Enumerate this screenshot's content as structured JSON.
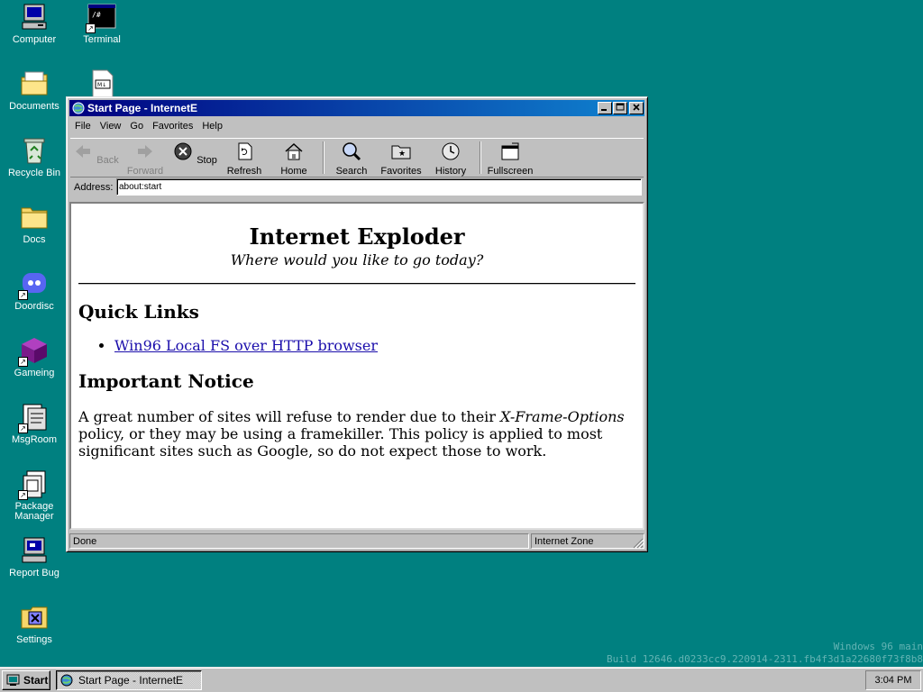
{
  "desktop": {
    "icons": [
      {
        "label": "Computer"
      },
      {
        "label": "Terminal"
      },
      {
        "label": "Documents"
      },
      {
        "label": "Recycle Bin"
      },
      {
        "label": "Docs"
      },
      {
        "label": "Doordisc"
      },
      {
        "label": "Gameing"
      },
      {
        "label": "MsgRoom"
      },
      {
        "label": "Package Manager"
      },
      {
        "label": "Report Bug"
      },
      {
        "label": "Settings"
      }
    ],
    "background_color": "#008080"
  },
  "window": {
    "title": "Start Page - InternetE",
    "menu": [
      "File",
      "View",
      "Go",
      "Favorites",
      "Help"
    ],
    "toolbar": {
      "back": "Back",
      "forward": "Forward",
      "stop": "Stop",
      "refresh": "Refresh",
      "home": "Home",
      "search": "Search",
      "favorites": "Favorites",
      "history": "History",
      "fullscreen": "Fullscreen"
    },
    "address": {
      "label": "Address:",
      "value": "about:start"
    },
    "page": {
      "heading": "Internet Exploder",
      "tagline": "Where would you like to go today?",
      "quick_links_heading": "Quick Links",
      "quick_links": [
        "Win96 Local FS over HTTP browser"
      ],
      "notice_heading": "Important Notice",
      "notice_pre": "A great number of sites will refuse to render due to their ",
      "notice_em": "X-Frame-Options",
      "notice_post": " policy, or they may be using a framekiller. This policy is applied to most significant sites such as Google, so do not expect those to work."
    },
    "status": {
      "left": "Done",
      "zone": "Internet Zone"
    }
  },
  "taskbar": {
    "start": "Start",
    "task": "Start Page - InternetE",
    "clock": "3:04 PM"
  },
  "watermark": {
    "line1": "Windows 96 main",
    "line2": "Build 12646.d0233cc9.220914-2311.fb4f3d1a22680f73f8b8"
  }
}
